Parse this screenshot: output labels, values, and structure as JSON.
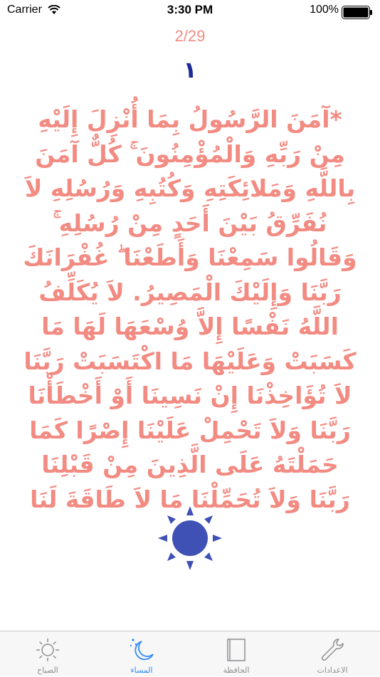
{
  "status_bar": {
    "carrier": "Carrier",
    "time": "3:30 PM",
    "battery": "100%"
  },
  "counter": {
    "page": "2/29",
    "count": "١"
  },
  "dhikr": {
    "text": "*آمَنَ الرَّسُولُ بِمَا أُنْزِلَ إِلَيْهِ مِنْ رَبِّهِ وَالْمُؤْمِنُونَ ۚ كُلٌّ آمَنَ بِاللَّهِ وَمَلائِكَتِهِ وَكُتُبِهِ وَرُسُلِهِ لاَ نُفَرِّقُ بَيْنَ أَحَدٍ مِنْ رُسُلِهِ ۚ وَقَالُوا سَمِعْنَا وَأَطَعْنَا ۖ غُفْرَانَكَ رَبَّنَا وَإِلَيْكَ الْمَصِيرُ. لاَ يُكَلِّفُ اللَّهُ نَفْسًا إِلاَّ وُسْعَهَا لَهَا مَا كَسَبَتْ وَعَلَيْهَا مَا اكْتَسَبَتْ رَبَّنَا لاَ تُؤَاخِذْنَا إِنْ نَسِينَا أَوْ أَخْطَأْنَا رَبَّنَا وَلاَ تَحْمِلْ عَلَيْنَا إِصْرًا كَمَا حَمَلْتَهُ عَلَى الَّذِينَ مِنْ قَبْلِنَا رَبَّنَا وَلاَ تُحَمِّلْنَا مَا لاَ طَاقَةَ لَنَا"
  },
  "colors": {
    "text": "#f28b82",
    "count": "#1e2a96",
    "sun": "#3f51b5",
    "tab_active": "#2f8af5",
    "tab_inactive": "#8e8e93"
  },
  "center_icon": "sun-icon",
  "tabs": [
    {
      "label": "الصباح",
      "icon": "sun-outline-icon"
    },
    {
      "label": "المساء",
      "icon": "moon-icon"
    },
    {
      "label": "الحافظة",
      "icon": "book-icon"
    },
    {
      "label": "الاعدادات",
      "icon": "wrench-icon"
    }
  ]
}
